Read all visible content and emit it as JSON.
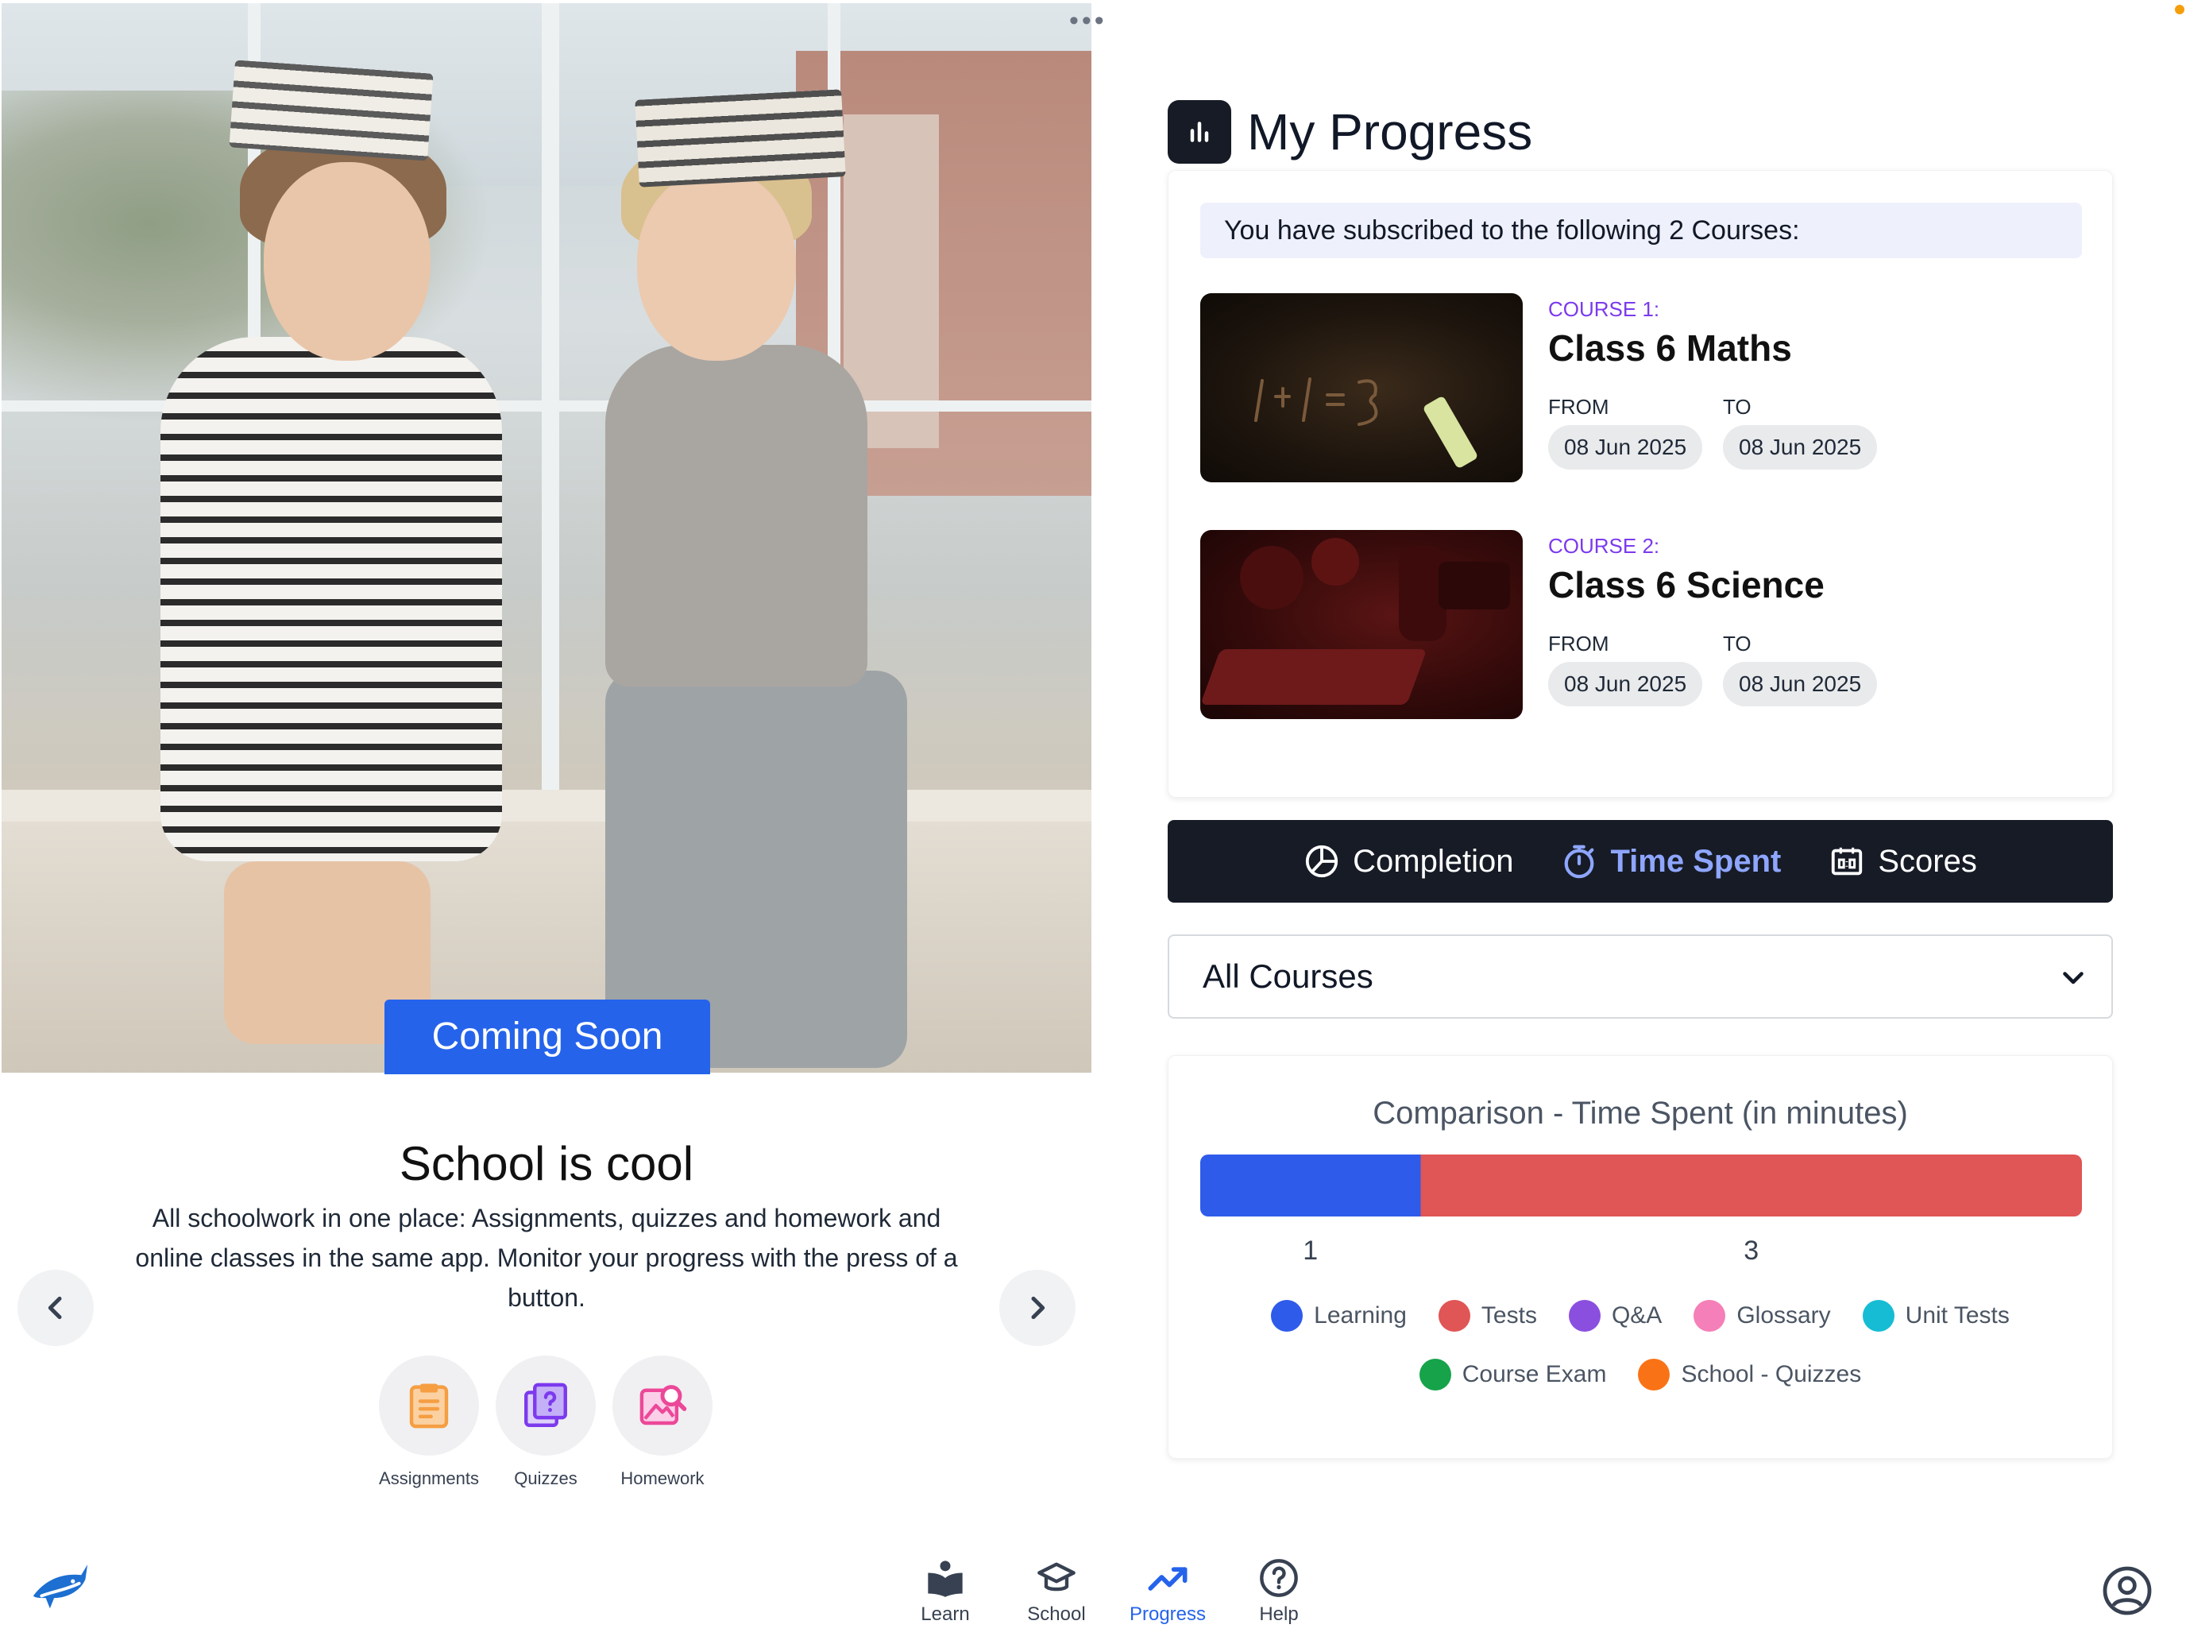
{
  "hero": {
    "badge": "Coming Soon",
    "title": "School is cool",
    "description": "All schoolwork in one place: Assignments, quizzes and homework and online classes in the same app. Monitor your progress with the press of a button."
  },
  "features": [
    {
      "label": "Assignments",
      "icon": "clipboard-icon",
      "color": "#f59e42"
    },
    {
      "label": "Quizzes",
      "icon": "quiz-book-icon",
      "color": "#7c3aed"
    },
    {
      "label": "Homework",
      "icon": "image-search-icon",
      "color": "#ec4899"
    }
  ],
  "progress": {
    "title": "My Progress",
    "subscribed_text": "You have subscribed to the following 2 Courses:",
    "courses": [
      {
        "label": "COURSE 1:",
        "name": "Class 6 Maths",
        "from_label": "FROM",
        "to_label": "TO",
        "from": "08 Jun 2025",
        "to": "08 Jun 2025"
      },
      {
        "label": "COURSE 2:",
        "name": "Class 6 Science",
        "from_label": "FROM",
        "to_label": "TO",
        "from": "08 Jun 2025",
        "to": "08 Jun 2025"
      }
    ],
    "tabs": [
      {
        "label": "Completion",
        "icon": "pie-chart-icon",
        "active": false
      },
      {
        "label": "Time Spent",
        "icon": "stopwatch-icon",
        "active": true
      },
      {
        "label": "Scores",
        "icon": "scoreboard-icon",
        "active": false
      }
    ],
    "filter": {
      "selected": "All Courses"
    }
  },
  "chart_data": {
    "type": "bar",
    "orientation": "horizontal-stacked",
    "title": "Comparison - Time Spent (in minutes)",
    "series": [
      {
        "name": "Learning",
        "value": 1,
        "color": "#2f5bea"
      },
      {
        "name": "Tests",
        "value": 3,
        "color": "#e05555"
      }
    ],
    "data_labels": [
      "1",
      "3"
    ],
    "legend": [
      {
        "name": "Learning",
        "color": "#2f5bea"
      },
      {
        "name": "Tests",
        "color": "#e05555"
      },
      {
        "name": "Q&A",
        "color": "#8b4fe0"
      },
      {
        "name": "Glossary",
        "color": "#f57fb8"
      },
      {
        "name": "Unit Tests",
        "color": "#16bcd4"
      },
      {
        "name": "Course Exam",
        "color": "#16a34a"
      },
      {
        "name": "School - Quizzes",
        "color": "#f97316"
      }
    ],
    "legend_placement": "bottom"
  },
  "bottom_nav": [
    {
      "label": "Learn",
      "icon": "book-reader-icon",
      "active": false
    },
    {
      "label": "School",
      "icon": "graduation-cap-icon",
      "active": false
    },
    {
      "label": "Progress",
      "icon": "trending-up-icon",
      "active": true
    },
    {
      "label": "Help",
      "icon": "help-circle-icon",
      "active": false
    }
  ]
}
